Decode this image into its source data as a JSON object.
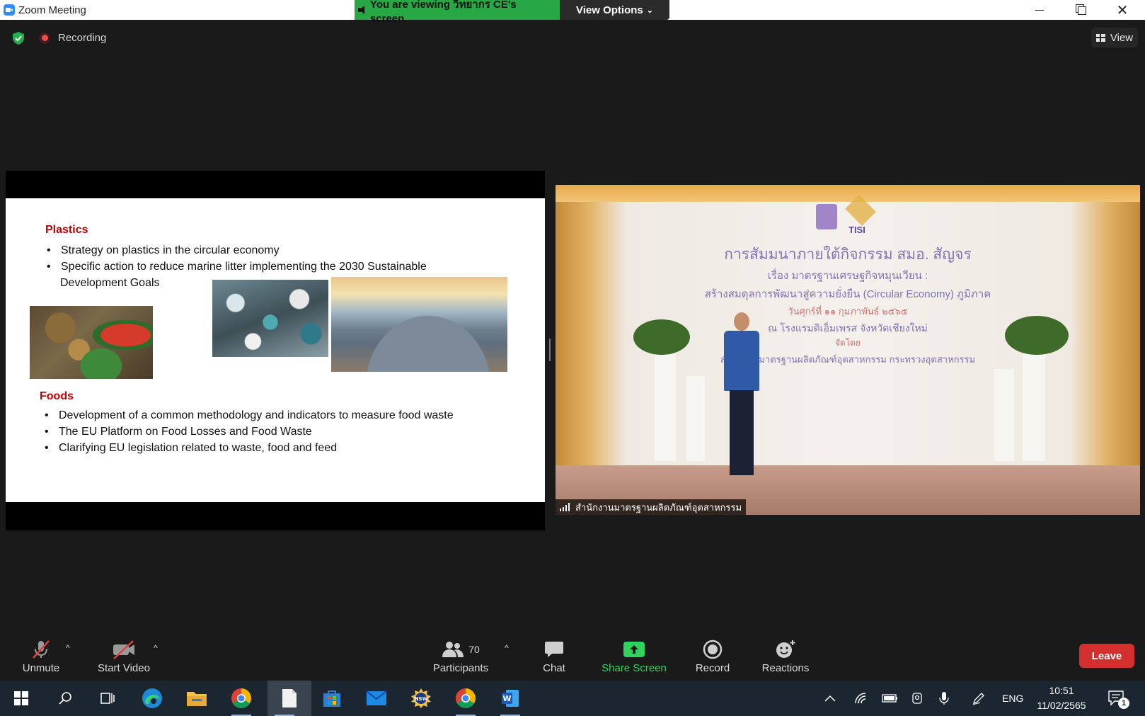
{
  "window": {
    "title": "Zoom Meeting"
  },
  "banner": {
    "viewing_text": "You are viewing วิทยากร CE's screen",
    "view_options_label": "View Options",
    "view_options_chevron": "⌄"
  },
  "top_bar": {
    "recording_label": "Recording",
    "view_label": "View"
  },
  "slide": {
    "plastics_heading": "Plastics",
    "plastics_bullets": [
      "Strategy on plastics in the circular economy",
      "Specific action to reduce marine litter implementing the 2030 Sustainable",
      "Development Goals"
    ],
    "foods_heading": "Foods",
    "foods_bullets": [
      "Development of a common methodology and indicators to measure food waste",
      "The EU Platform on Food Losses and Food Waste",
      "Clarifying EU legislation related to waste, food and feed"
    ]
  },
  "video": {
    "stage_lines": [
      "การสัมมนาภายใต้กิจกรรม สมอ. สัญจร",
      "เรื่อง มาตรฐานเศรษฐกิจหมุนเวียน :",
      "สร้างสมดุลการพัฒนาสู่ความยั่งยืน (Circular Economy) ภูมิภาค",
      "วันศุกร์ที่ ๑๑ กุมภาพันธ์ ๒๕๖๕",
      "ณ โรงแรมดิเอ็มเพรส จังหวัดเชียงใหม่",
      "จัดโดย",
      "สำนักงานมาตรฐานผลิตภัณฑ์อุตสาหกรรม กระทรวงอุตสาหกรรม"
    ],
    "logo_text": "TISI",
    "participant_name": "สำนักงานมาตรฐานผลิตภัณฑ์อุตสาหกรรม"
  },
  "controls": {
    "unmute": "Unmute",
    "start_video": "Start Video",
    "participants": "Participants",
    "participants_count": "70",
    "chat": "Chat",
    "share_screen": "Share Screen",
    "record": "Record",
    "reactions": "Reactions",
    "leave": "Leave",
    "caret": "^"
  },
  "taskbar": {
    "apps": [
      "windows-start",
      "search",
      "task-view",
      "edge",
      "file-explorer",
      "chrome",
      "notepad",
      "microsoft-store",
      "mail",
      "nsw",
      "chrome",
      "word"
    ],
    "language": "ENG",
    "time": "10:51",
    "date": "11/02/2565",
    "notification_count": "1"
  },
  "colors": {
    "accent_green": "#2fd35a",
    "leave_red": "#d32f2f",
    "banner_green": "#28a745",
    "slide_heading_red": "#c00000"
  }
}
